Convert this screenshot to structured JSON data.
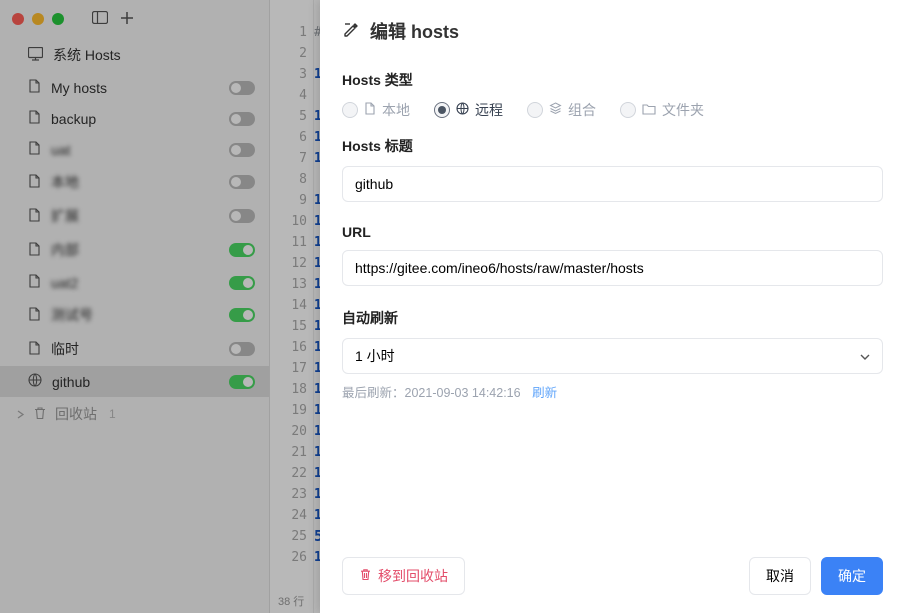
{
  "sidebar": {
    "system_hosts": "系统 Hosts",
    "items": [
      {
        "label": "My hosts",
        "toggle": "off",
        "blur": false
      },
      {
        "label": "backup",
        "toggle": "off",
        "blur": false
      },
      {
        "label": "uat",
        "toggle": "off",
        "blur": true
      },
      {
        "label": "本地",
        "toggle": "off",
        "blur": true
      },
      {
        "label": "扩展",
        "toggle": "off",
        "blur": true
      },
      {
        "label": "内部",
        "toggle": "on",
        "blur": true
      },
      {
        "label": "uat2",
        "toggle": "on",
        "blur": true
      },
      {
        "label": "测试号",
        "toggle": "on",
        "blur": true
      },
      {
        "label": "临时",
        "toggle": "off",
        "blur": false
      },
      {
        "label": "github",
        "toggle": "on",
        "blur": false,
        "selected": true,
        "icon": "globe"
      }
    ],
    "trash": {
      "label": "回收站",
      "count": "1"
    }
  },
  "editor": {
    "line_first_chars": [
      "#",
      "",
      "1",
      "",
      "1",
      "1",
      "1",
      "",
      "1",
      "1",
      "1",
      "1",
      "1",
      "1",
      "1",
      "1",
      "1",
      "1",
      "1",
      "1",
      "1",
      "1",
      "1",
      "1",
      "5",
      "1"
    ],
    "status": "38 行"
  },
  "modal": {
    "title": "编辑 hosts",
    "type_label": "Hosts 类型",
    "types": {
      "local": "本地",
      "remote": "远程",
      "group": "组合",
      "folder": "文件夹"
    },
    "title_label": "Hosts 标题",
    "title_value": "github",
    "url_label": "URL",
    "url_value": "https://gitee.com/ineo6/hosts/raw/master/hosts",
    "refresh_label": "自动刷新",
    "refresh_value": "1 小时",
    "last_refresh_prefix": "最后刷新：",
    "last_refresh_time": "2021-09-03 14:42:16",
    "refresh_link": "刷新",
    "move_trash": "移到回收站",
    "cancel": "取消",
    "confirm": "确定"
  }
}
